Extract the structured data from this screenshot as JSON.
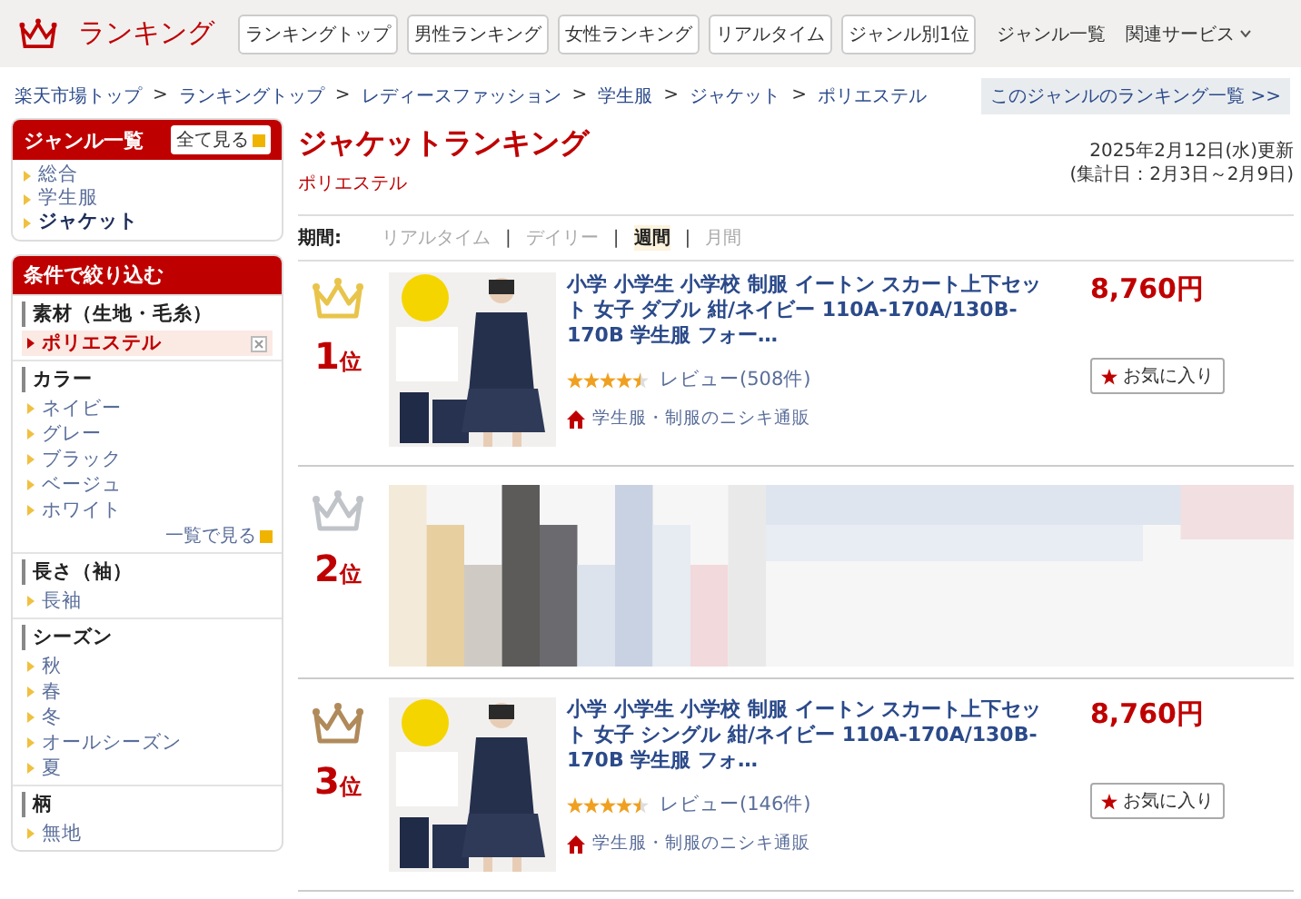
{
  "header": {
    "logo_text": "ランキング",
    "nav_buttons": [
      "ランキングトップ",
      "男性ランキング",
      "女性ランキング",
      "リアルタイム",
      "ジャンル別1位"
    ],
    "links": [
      {
        "label": "ジャンル一覧",
        "caret": false
      },
      {
        "label": "関連サービス",
        "caret": true
      }
    ]
  },
  "breadcrumb": {
    "items": [
      "楽天市場トップ",
      "ランキングトップ",
      "レディースファッション",
      "学生服",
      "ジャケット",
      "ポリエステル"
    ],
    "separator": ">",
    "all_link": "このジャンルのランキング一覧 >>"
  },
  "genre_box": {
    "title": "ジャンル一覧",
    "see_all": "全て見る",
    "items": [
      {
        "label": "総合",
        "current": false
      },
      {
        "label": "学生服",
        "current": false
      },
      {
        "label": "ジャケット",
        "current": true
      }
    ]
  },
  "filter_box": {
    "title": "条件で絞り込む",
    "groups": [
      {
        "heading": "素材（生地・毛糸）",
        "items": [
          {
            "label": "ポリエステル",
            "selected": true
          }
        ]
      },
      {
        "heading": "カラー",
        "items": [
          {
            "label": "ネイビー",
            "selected": false
          },
          {
            "label": "グレー",
            "selected": false
          },
          {
            "label": "ブラック",
            "selected": false
          },
          {
            "label": "ベージュ",
            "selected": false
          },
          {
            "label": "ホワイト",
            "selected": false
          }
        ],
        "more": "一覧で見る"
      },
      {
        "heading": "長さ（袖）",
        "items": [
          {
            "label": "長袖",
            "selected": false
          }
        ]
      },
      {
        "heading": "シーズン",
        "items": [
          {
            "label": "秋",
            "selected": false
          },
          {
            "label": "春",
            "selected": false
          },
          {
            "label": "冬",
            "selected": false
          },
          {
            "label": "オールシーズン",
            "selected": false
          },
          {
            "label": "夏",
            "selected": false
          }
        ]
      },
      {
        "heading": "柄",
        "items": [
          {
            "label": "無地",
            "selected": false
          }
        ]
      }
    ]
  },
  "main": {
    "title": "ジャケットランキング",
    "subtitle": "ポリエステル",
    "updated": "2025年2月12日(水)更新",
    "period_note": "(集計日：2月3日～2月9日)",
    "period_label": "期間:",
    "period_separator": "|",
    "periods": [
      {
        "label": "リアルタイム",
        "selected": false
      },
      {
        "label": "デイリー",
        "selected": false
      },
      {
        "label": "週間",
        "selected": true
      },
      {
        "label": "月間",
        "selected": false
      }
    ]
  },
  "items": [
    {
      "kind": "product",
      "rank": "1",
      "rank_suffix": "位",
      "color": "#e8c44a",
      "title": "小学 小学生 小学校 制服 イートン スカート上下セット 女子 ダブル 紺/ネイビー 110A-170A/130B-170B 学生服 フォー…",
      "price": "8,760円",
      "stars": 4.5,
      "reviews": "レビュー(508件)",
      "shop": "学生服・制服のニシキ通販",
      "favorite": "お気に入り"
    },
    {
      "kind": "blurred",
      "rank": "2",
      "rank_suffix": "位",
      "color": "#c0c4c8"
    },
    {
      "kind": "product",
      "rank": "3",
      "rank_suffix": "位",
      "color": "#b08a5a",
      "title": "小学 小学生 小学校 制服 イートン スカート上下セット 女子 シングル 紺/ネイビー 110A-170A/130B-170B 学生服 フォ…",
      "price": "8,760円",
      "stars": 4.5,
      "reviews": "レビュー(146件)",
      "shop": "学生服・制服のニシキ通販",
      "favorite": "お気に入り"
    }
  ]
}
